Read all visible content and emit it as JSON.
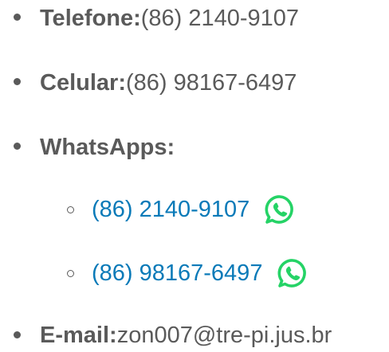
{
  "contacts": {
    "telefone_label": "Telefone:",
    "telefone_value": " (86) 2140-9107",
    "celular_label": "Celular:",
    "celular_value": " (86) 98167-6497",
    "whatsapps_label": "WhatsApps:",
    "whatsapp_numbers": [
      {
        "number": "(86) 2140-9107",
        "icon": "whatsapp-icon"
      },
      {
        "number": "(86) 98167-6497",
        "icon": "whatsapp-icon"
      }
    ],
    "email_label": "E-mail:",
    "email_value": " zon007@tre-pi.jus.br"
  },
  "colors": {
    "text": "#5a5a5a",
    "link": "#0a7ab8",
    "whatsapp": "#25d366"
  }
}
